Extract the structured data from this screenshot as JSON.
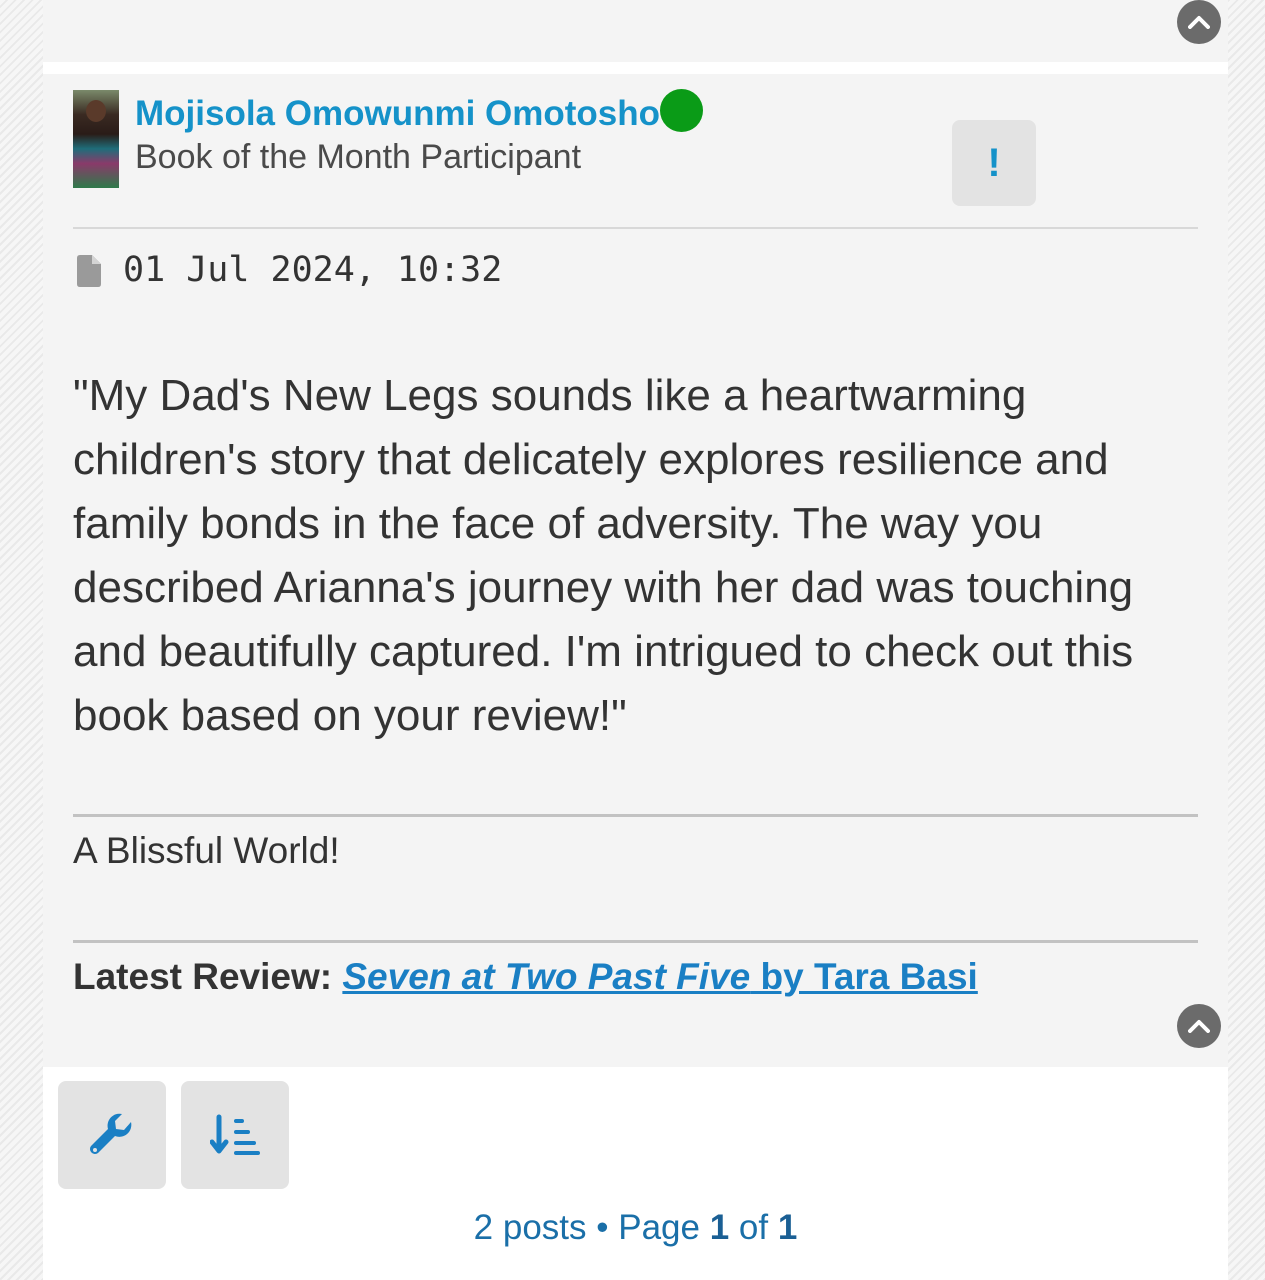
{
  "previous_post": {
    "back_to_top_icon": "chevron-up-icon"
  },
  "post": {
    "author": {
      "name": "Mojisola Omowunmi Omotosho",
      "rank": "Book of the Month Participant",
      "online": true,
      "online_color": "#0a9b17",
      "avatar": "user-avatar-photo"
    },
    "report_button_label": "!",
    "post_icon": "file-icon",
    "date": "01 Jul 2024, 10:32",
    "content": "\"My Dad's New Legs sounds like a heartwarming children's story that delicately explores resilience and family bonds in the face of adversity. The way you described Arianna's journey with her dad was touching and beautifully captured. I'm intrigued to check out this book based on your review!\"",
    "signature": "A Blissful World!",
    "latest_review": {
      "label": "Latest Review:",
      "book_title": "Seven at Two Past Five",
      "by_author": "by Tara Basi"
    },
    "back_to_top_icon": "chevron-up-icon"
  },
  "toolbar": {
    "tools_icon": "wrench-icon",
    "sort_icon": "sort-descending-icon"
  },
  "pagination": {
    "posts_text": "2 posts",
    "separator": " • ",
    "page_label": "Page",
    "current_page": "1",
    "of_label": "of",
    "total_pages": "1"
  },
  "colors": {
    "accent": "#1592c9",
    "link": "#1a7fc4",
    "post_background": "#f4f4f4",
    "button_background": "#e3e3e3"
  }
}
